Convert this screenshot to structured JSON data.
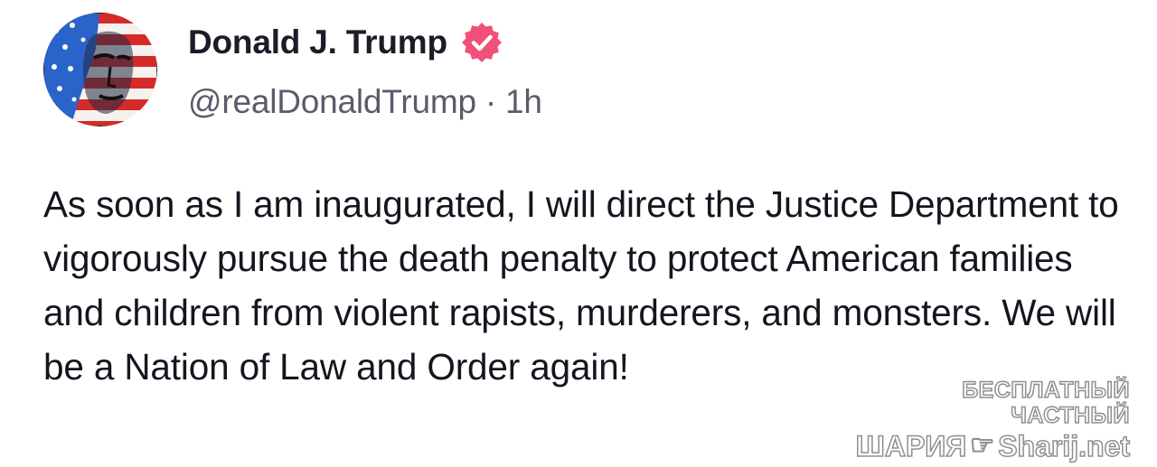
{
  "post": {
    "author": {
      "display_name": "Donald J. Trump",
      "handle": "@realDonaldTrump",
      "verified": true,
      "avatar": "avatar-portrait-american-flag"
    },
    "separator": "·",
    "timestamp": "1h",
    "text": "As soon as I am inaugurated, I will direct the Justice Department to vigorously pursue the death penalty to protect American families and children from violent rapists, murderers, and monsters. We will be a Nation of Law and Order again!"
  },
  "watermark": {
    "line1": "БЕСПЛАТНЫЙ ЧАСТНЫЙ",
    "line2_left": "ШАРИЯ",
    "line2_icon": "pointing-hand-icon",
    "line2_right": "Sharij.net"
  },
  "colors": {
    "verified_badge": "#f0507a",
    "text": "#15151f",
    "meta": "#5a5b6b",
    "background": "#ffffff"
  }
}
